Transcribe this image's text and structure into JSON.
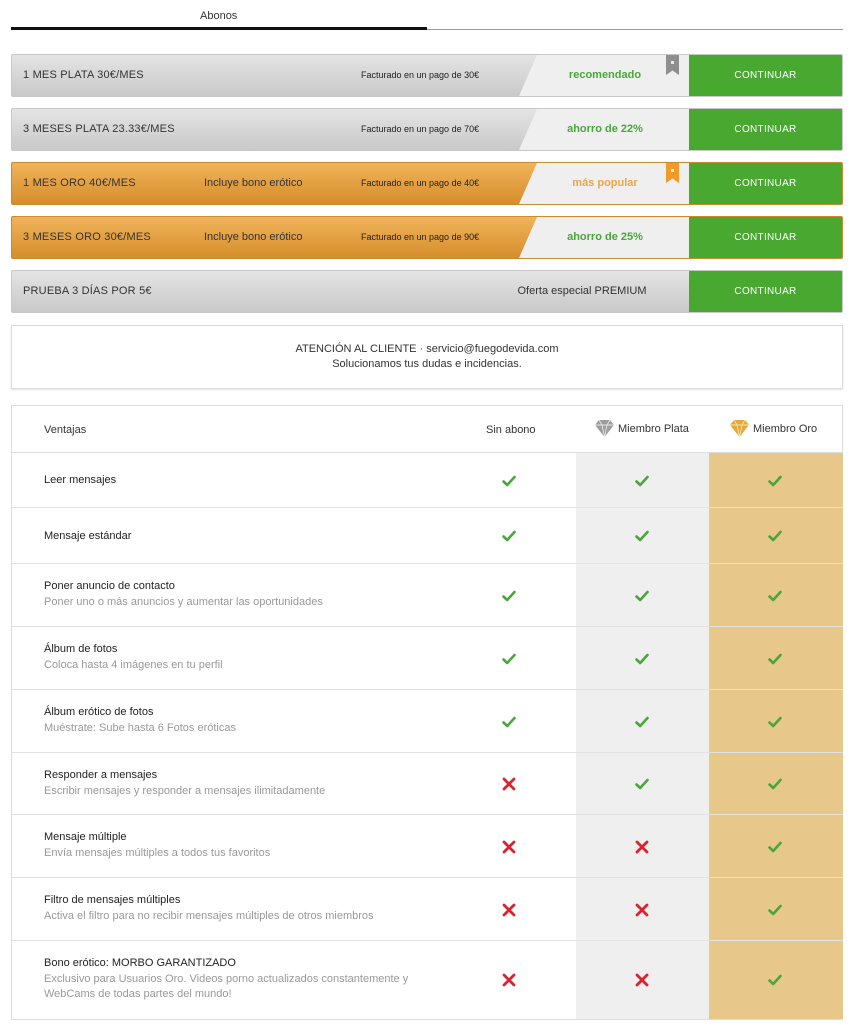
{
  "tabs": {
    "active_label": "Abonos"
  },
  "plans": [
    {
      "title": "1 MES PLATA 30€/MES",
      "extra": "",
      "billing": "Facturado en un pago de 30€",
      "badge": "recomendado",
      "button": "CONTINUAR"
    },
    {
      "title": "3 MESES PLATA 23.33€/MES",
      "extra": "",
      "billing": "Facturado en un pago de 70€",
      "badge": "ahorro de 22%",
      "button": "CONTINUAR"
    },
    {
      "title": "1 MES ORO 40€/MES",
      "extra": "Incluye bono erótico",
      "billing": "Facturado en un pago de 40€",
      "badge": "más popular",
      "button": "CONTINUAR"
    },
    {
      "title": "3 MESES ORO 30€/MES",
      "extra": "Incluye bono erótico",
      "billing": "Facturado en un pago de 90€",
      "badge": "ahorro de 25%",
      "button": "CONTINUAR"
    },
    {
      "title": "PRUEBA 3 DÍAS POR 5€",
      "extra": "",
      "billing": "",
      "badge": "Oferta especial PREMIUM",
      "button": "CONTINUAR"
    }
  ],
  "support": {
    "line1": "ATENCIÓN AL CLIENTE · servicio@fuegodevida.com",
    "line2": "Solucionamos tus dudas e incidencias."
  },
  "features": {
    "headers": {
      "ventajas": "Ventajas",
      "sin_abono": "Sin abono",
      "plata": "Miembro Plata",
      "oro": "Miembro Oro"
    },
    "rows": [
      {
        "title": "Leer mensajes",
        "desc": "",
        "sin": true,
        "plata": true,
        "oro": true
      },
      {
        "title": "Mensaje estándar",
        "desc": "",
        "sin": true,
        "plata": true,
        "oro": true
      },
      {
        "title": "Poner anuncio de contacto",
        "desc": "Poner uno o más anuncios y aumentar las oportunidades",
        "sin": true,
        "plata": true,
        "oro": true
      },
      {
        "title": "Álbum de fotos",
        "desc": "Coloca hasta 4 imágenes en tu perfil",
        "sin": true,
        "plata": true,
        "oro": true
      },
      {
        "title": "Álbum erótico de fotos",
        "desc": "Muéstrate: Sube hasta 6 Fotos eróticas",
        "sin": true,
        "plata": true,
        "oro": true
      },
      {
        "title": "Responder a mensajes",
        "desc": "Escribir mensajes y responder a mensajes ilimitadamente",
        "sin": false,
        "plata": true,
        "oro": true
      },
      {
        "title": "Mensaje múltiple",
        "desc": "Envía mensajes múltiples a todos tus favoritos",
        "sin": false,
        "plata": false,
        "oro": true
      },
      {
        "title": "Filtro de mensajes múltiples",
        "desc": "Activa el filtro para no recibir mensajes múltiples de otros miembros",
        "sin": false,
        "plata": false,
        "oro": true
      },
      {
        "title": "Bono erótico: MORBO GARANTIZADO",
        "desc": "Exclusivo para Usuarios Oro. Videos porno actualizados constantemente y WebCams de todas partes del mundo!",
        "sin": false,
        "plata": false,
        "oro": true
      }
    ]
  }
}
